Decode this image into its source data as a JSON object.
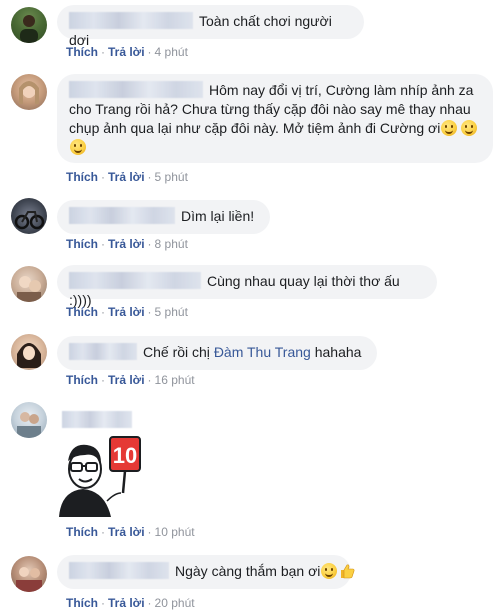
{
  "actions": {
    "like": "Thích",
    "reply": "Trả lời",
    "dot": "·"
  },
  "colors": {
    "bubble_bg": "#f2f3f5",
    "link": "#385898",
    "muted": "#90949c",
    "text": "#1c1e21"
  },
  "comments": [
    {
      "text": "Toàn chất chơi người dơi",
      "time": "4 phút"
    },
    {
      "text_line1": "Hôm nay đổi vị trí, Cường làm nhíp ảnh za",
      "text_line2": "cho Trang rồi hả? Chưa từng thấy cặp đôi nào say mê thay nhau",
      "text_line3": "chụp ảnh qua lại như cặp đôi này. Mở tiệm ảnh đi Cường ơi",
      "time": "5 phút"
    },
    {
      "text": "Dìm lại liền!",
      "time": "8 phút"
    },
    {
      "text": "Cùng nhau quay lại thời thơ ấu :))))",
      "time": "5 phút"
    },
    {
      "text_before": "Chế rồi chị",
      "mention": "Đàm Thu Trang",
      "text_after": "hahaha",
      "time": "16 phút"
    },
    {
      "sticker_number": "10",
      "sticker": "sticker-man-holding-score-sign",
      "time": "10 phút"
    },
    {
      "text": "Ngày càng thắm bạn ơi",
      "time": "20 phút"
    }
  ]
}
